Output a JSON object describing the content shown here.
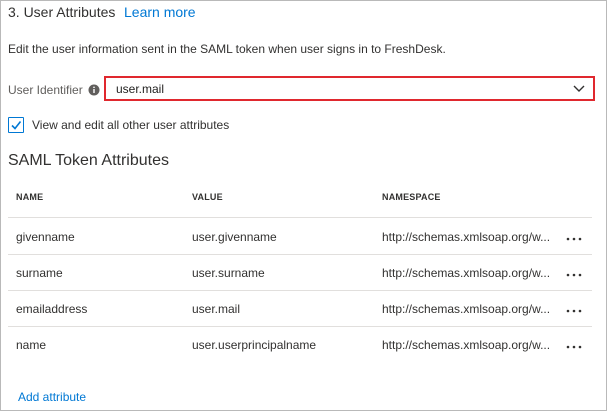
{
  "section": {
    "title": "3. User Attributes",
    "learn_more": "Learn more",
    "description": "Edit the user information sent in the SAML token when user signs in to FreshDesk."
  },
  "user_identifier": {
    "label": "User Identifier",
    "value": "user.mail",
    "info_icon": "info-icon",
    "chevron_icon": "chevron-down-icon"
  },
  "view_edit": {
    "checked": true,
    "label": "View and edit all other user attributes"
  },
  "saml": {
    "heading": "SAML Token Attributes",
    "columns": [
      "NAME",
      "VALUE",
      "NAMESPACE"
    ],
    "rows": [
      {
        "name": "givenname",
        "value": "user.givenname",
        "namespace": "http://schemas.xmlsoap.org/w..."
      },
      {
        "name": "surname",
        "value": "user.surname",
        "namespace": "http://schemas.xmlsoap.org/w..."
      },
      {
        "name": "emailaddress",
        "value": "user.mail",
        "namespace": "http://schemas.xmlsoap.org/w..."
      },
      {
        "name": "name",
        "value": "user.userprincipalname",
        "namespace": "http://schemas.xmlsoap.org/w..."
      }
    ],
    "more_icon": "more-horizontal-icon",
    "add_attribute": "Add attribute"
  },
  "colors": {
    "accent": "#0078d4",
    "highlight": "#e0282e",
    "text": "#323130",
    "divider": "#e1dfdd"
  }
}
